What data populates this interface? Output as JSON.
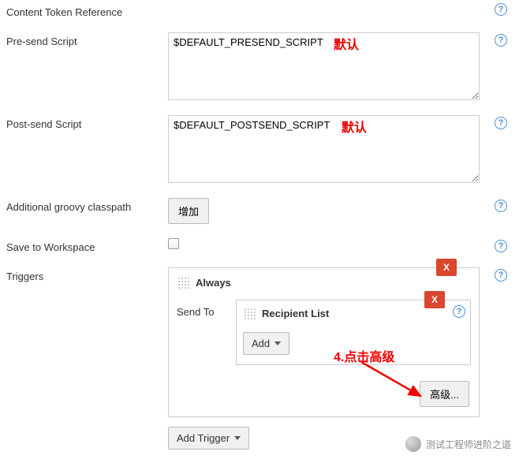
{
  "rows": {
    "content_token_ref": "Content Token Reference",
    "presend": {
      "label": "Pre-send Script",
      "value": "$DEFAULT_PRESEND_SCRIPT"
    },
    "postsend": {
      "label": "Post-send Script",
      "value": "$DEFAULT_POSTSEND_SCRIPT"
    },
    "classpath": {
      "label": "Additional groovy classpath",
      "button": "增加"
    },
    "save_workspace": "Save to Workspace",
    "triggers": "Triggers"
  },
  "trigger": {
    "always": "Always",
    "sendto": "Send To",
    "recipient_list": "Recipient List",
    "add": "Add",
    "advanced": "高级...",
    "close": "X"
  },
  "add_trigger": "Add Trigger",
  "annotations": {
    "default1": "默认",
    "default2": "默认",
    "step4": "4.点击高级"
  },
  "watermark": "测试工程师进阶之道"
}
